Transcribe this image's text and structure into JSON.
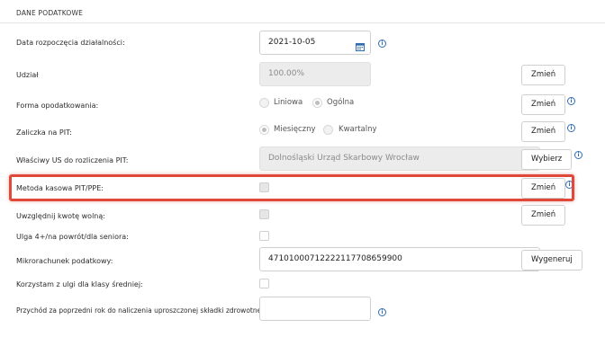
{
  "section": {
    "title": "DANE PODATKOWE"
  },
  "rows": {
    "start_date": {
      "label": "Data rozpoczęcia działalności:",
      "value": "2021-10-05"
    },
    "share": {
      "label": "Udział",
      "value": "100.00%",
      "button": "Zmień"
    },
    "tax_form": {
      "label": "Forma opodatkowania:",
      "option1": "Liniowa",
      "option2": "Ogólna",
      "selected": "Ogólna",
      "button": "Zmień"
    },
    "pit_advance": {
      "label": "Zaliczka na PIT:",
      "option1": "Miesięczny",
      "option2": "Kwartalny",
      "selected": "Miesięczny",
      "button": "Zmień"
    },
    "tax_office": {
      "label": "Właściwy US do rozliczenia PIT:",
      "value": "Dolnośląski Urząd Skarbowy Wrocław",
      "button": "Wybierz"
    },
    "cash_method": {
      "label": "Metoda kasowa PIT/PPE:",
      "button": "Zmień"
    },
    "tax_free": {
      "label": "Uwzględnij kwotę wolną:",
      "button": "Zmień"
    },
    "relief": {
      "label": "Ulga 4+/na powrót/dla seniora:"
    },
    "micro_account": {
      "label": "Mikrorachunek podatkowy:",
      "value": "47101000712222117708659900",
      "button": "Wygeneruj"
    },
    "middle_class": {
      "label": "Korzystam z ulgi dla klasy średniej:"
    },
    "prev_income": {
      "label": "Przychód za poprzedni rok do naliczenia uproszczonej składki zdrowotnej:",
      "value": ""
    }
  },
  "colors": {
    "highlight": "#e0493a",
    "info": "#2e6db4"
  }
}
